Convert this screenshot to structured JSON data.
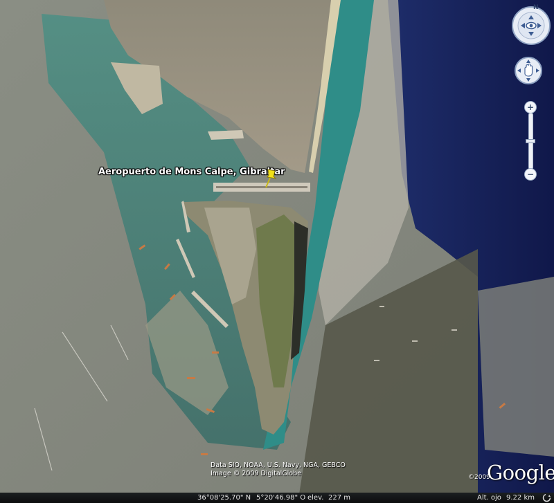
{
  "placemark": {
    "label": "Aeropuerto de Mons Calpe, Gibraltar",
    "icon": "pushpin-icon",
    "color": "#f2e21a"
  },
  "navigation": {
    "north_letter": "N",
    "compass_icon": "compass-look-icon",
    "move_icon": "hand-move-icon",
    "zoom_in": "+",
    "zoom_out": "−"
  },
  "attribution": {
    "data": "Data SIO, NOAA, U.S. Navy, NGA, GEBCO",
    "image": "Image © 2009 DigitalGlobe"
  },
  "logo": {
    "year": "©2009",
    "word": "Google"
  },
  "statusbar": {
    "lat": "36°08'25.70\" N",
    "lon": "5°20'46.98\" O",
    "elev_label": "elev.",
    "elev_value": "227 m",
    "eye_label": "Alt. ojo",
    "eye_value": "9.22 km",
    "streaming_icon": "streaming-progress-icon"
  }
}
